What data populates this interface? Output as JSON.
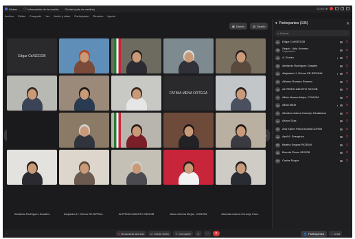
{
  "titlebar": {
    "app_name": "Webex",
    "meeting_info": "Información de la reunión",
    "room": "Ciudad (sala de medios)",
    "time": "01:24:18"
  },
  "menubar": [
    "Archivo",
    "Editar",
    "Compartir",
    "Ver",
    "Audio y video",
    "Participante",
    "Reunión",
    "Ayuda"
  ],
  "video_toolbar": {
    "layout_button": "Diseño",
    "popout_button": "Diseño"
  },
  "tiles": [
    {
      "name": "Edgar Cd/SEGOB",
      "kind": "named"
    },
    {
      "name": "",
      "kind": "video",
      "bg": "#5f8fb8",
      "hair": "#b5482a",
      "body": "#7a4a3a"
    },
    {
      "name": "",
      "kind": "video",
      "bg": "#6d6a60",
      "hair": "#2a2320",
      "body": "#2c2a32"
    },
    {
      "name": "",
      "kind": "video",
      "bg": "#7d8a90",
      "hair": "#d8d8d8",
      "body": "#2f3038"
    },
    {
      "name": "",
      "kind": "video",
      "bg": "#7a7060",
      "hair": "#2a2320",
      "body": "#5a4a3e"
    },
    {
      "name": "",
      "kind": "video",
      "bg": "#b9b9b4",
      "hair": "#3a2a22",
      "body": "#3a4456"
    },
    {
      "name": "",
      "kind": "video",
      "bg": "#9b8a7a",
      "hair": "#1d1a18",
      "body": "#2a3a50"
    },
    {
      "name": "",
      "kind": "video",
      "bg": "#c8c8c4",
      "hair": "#3a2a22",
      "body": "#e6e6e6"
    },
    {
      "name": "FATIMA MENA ORTEGA",
      "kind": "named"
    },
    {
      "name": "",
      "kind": "video",
      "bg": "#c2c6c8",
      "hair": "#2c2420",
      "body": "#4a5060"
    },
    {
      "name": "",
      "kind": "video",
      "bg": "#1a1a1c",
      "hair": "#1a1a1c",
      "body": "#1a1a1c"
    },
    {
      "name": "",
      "kind": "video",
      "bg": "#8a7a66",
      "hair": "#d0d0d0",
      "body": "#30343c"
    },
    {
      "name": "",
      "kind": "video",
      "bg": "#b8b4ae",
      "hair": "#2a1e1a",
      "body": "#7a1e28"
    },
    {
      "name": "",
      "kind": "video",
      "bg": "#6e4a3a",
      "hair": "#1e1816",
      "body": "#222226"
    },
    {
      "name": "",
      "kind": "video",
      "bg": "#b9b0a2",
      "hair": "#1e1816",
      "body": "#3a3a42"
    },
    {
      "name": "",
      "kind": "video",
      "bg": "#e4e2de",
      "hair": "#2a1e1a",
      "body": "#2a2a30"
    },
    {
      "name": "",
      "kind": "video",
      "bg": "#ddd6cc",
      "hair": "#5a4a3a",
      "body": "#6a5a50"
    },
    {
      "name": "",
      "kind": "video",
      "bg": "#c4c0b6",
      "hair": "#d0cfcc",
      "body": "#4a4a50"
    },
    {
      "name": "",
      "kind": "video",
      "bg": "#c8243a",
      "hair": "#2a1e1a",
      "body": "#f2f2f2"
    },
    {
      "name": "",
      "kind": "video",
      "bg": "#cfccc6",
      "hair": "#222",
      "body": "#2a2c34"
    }
  ],
  "name_row": [
    "Abelardo Rodríguez Dosales",
    "Alejandra H. Ochoa SE-SIPINA...",
    "ALFREDO ABUSTO SEGOB",
    "Alicia Jimena Mejía - CONVIM",
    "Alondra chávez-Consejo Ciud..."
  ],
  "bottombar": {
    "mute_label": "Desactivar silencio",
    "video_label": "Iniciar video",
    "share_label": "Compartir",
    "participants_label": "Participantes",
    "chat_label": "Chat"
  },
  "panel": {
    "title": "Participantes (105)",
    "search_placeholder": "Buscar",
    "participants": [
      {
        "initials": "EC",
        "name": "Edgar Cid/SEGOB",
        "sub": ""
      },
      {
        "initials": "SE",
        "name": "Segob. Lidia Jimenez",
        "sub": "Organizador"
      },
      {
        "initials": "AF",
        "name": "A. Enciso",
        "sub": ""
      },
      {
        "initials": "AR",
        "name": "Abelardo Rodríguez Dosales",
        "sub": ""
      },
      {
        "initials": "AO",
        "name": "Alejandra H. Ochoa SE-SIPINNA",
        "sub": ""
      },
      {
        "initials": "AR",
        "name": "Alfonso Romero Romero",
        "sub": ""
      },
      {
        "initials": "AA",
        "name": "ALFREDO ABUSTO SEGOB",
        "sub": ""
      },
      {
        "initials": "AJ",
        "name": "Alicia Jimena Mejía- CONVIM",
        "sub": ""
      },
      {
        "initials": "AM",
        "name": "Alicia Meza",
        "sub": ""
      },
      {
        "initials": "AC",
        "name": "Alondra chávez-Consejo Ciudadano",
        "sub": ""
      },
      {
        "initials": "AD",
        "name": "Alvaro Díaz",
        "sub": ""
      },
      {
        "initials": "AP",
        "name": "Ana Karen Parra Bonilla CDHEN",
        "sub": ""
      },
      {
        "initials": "AE",
        "name": "April A. Energinco",
        "sub": ""
      },
      {
        "initials": "BS",
        "name": "Beatriz Segura PATEMII",
        "sub": ""
      },
      {
        "initials": "BF",
        "name": "Brenda Flores SEGOB",
        "sub": ""
      },
      {
        "initials": "CR",
        "name": "Carlos Roque",
        "sub": ""
      }
    ]
  }
}
